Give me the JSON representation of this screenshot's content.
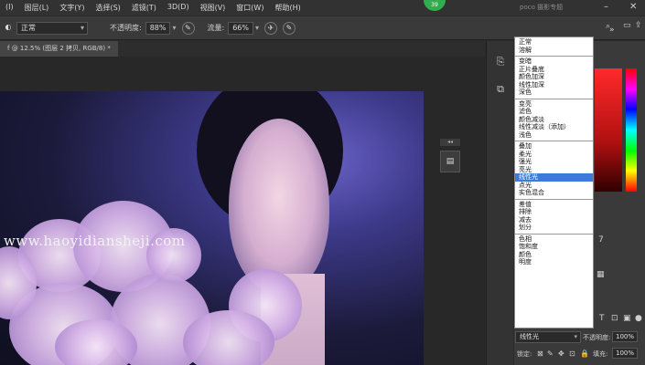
{
  "menubar": {
    "items": [
      {
        "label": "(I)"
      },
      {
        "label": "图层(L)"
      },
      {
        "label": "文字(Y)"
      },
      {
        "label": "选择(S)"
      },
      {
        "label": "滤镜(T)"
      },
      {
        "label": "3D(D)"
      },
      {
        "label": "视图(V)"
      },
      {
        "label": "窗口(W)"
      },
      {
        "label": "帮助(H)"
      }
    ],
    "notification_count": "39",
    "brand": "poco 摄影专题"
  },
  "options": {
    "mode_value": "正常",
    "opacity_label": "不透明度:",
    "opacity_value": "88%",
    "flow_label": "流量:",
    "flow_value": "66%"
  },
  "document": {
    "tab_title": "f @ 12.5% (图层 2 拷贝, RGB/8) *"
  },
  "watermark": "www.haoyidiansheji.com",
  "blend_dropdown": {
    "groups": [
      [
        "正常",
        "溶解"
      ],
      [
        "变暗",
        "正片叠底",
        "颜色加深",
        "线性加深",
        "深色"
      ],
      [
        "变亮",
        "滤色",
        "颜色减淡",
        "线性减淡（添加）",
        "浅色"
      ],
      [
        "叠加",
        "柔光",
        "强光",
        "亮光",
        "线性光",
        "点光",
        "实色混合"
      ],
      [
        "差值",
        "排除",
        "减去",
        "划分"
      ],
      [
        "色相",
        "饱和度",
        "颜色",
        "明度"
      ]
    ],
    "selected": "线性光"
  },
  "layers": {
    "blend_mode": "线性光",
    "opacity_label": "不透明度:",
    "opacity_value": "100%",
    "lock_label": "锁定:",
    "fill_label": "填充:",
    "fill_value": "100%"
  }
}
